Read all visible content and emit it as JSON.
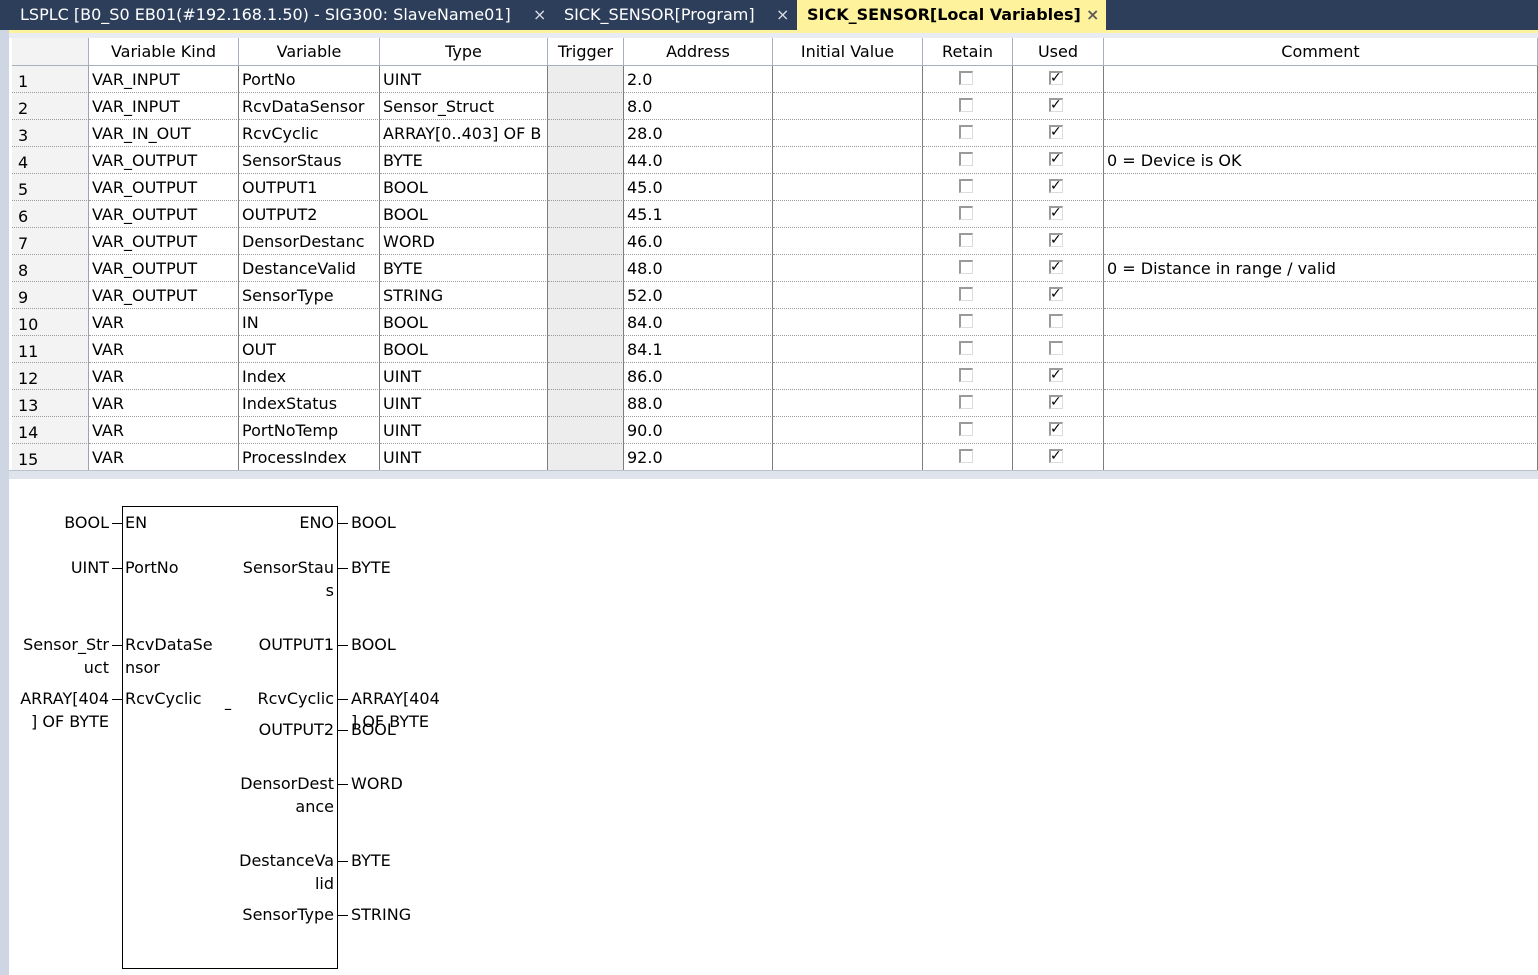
{
  "tabs": [
    {
      "label": "LSPLC [B0_S0 EB01(#192.168.1.50) - SIG300: SlaveName01]",
      "close": "×",
      "active": false
    },
    {
      "label": "SICK_SENSOR[Program]",
      "close": "×",
      "active": false
    },
    {
      "label": "SICK_SENSOR[Local Variables]",
      "close": "×",
      "active": true
    }
  ],
  "columns": [
    "",
    "Variable Kind",
    "Variable",
    "Type",
    "Trigger",
    "Address",
    "Initial Value",
    "Retain",
    "Used",
    "Comment"
  ],
  "rows": [
    {
      "no": "1",
      "kind": "VAR_INPUT",
      "variable": "PortNo",
      "type": "UINT",
      "trigger": "",
      "address": "2.0",
      "initial": "",
      "retain": false,
      "used": true,
      "comment": ""
    },
    {
      "no": "2",
      "kind": "VAR_INPUT",
      "variable": "RcvDataSensor",
      "type": "Sensor_Struct",
      "trigger": "",
      "address": "8.0",
      "initial": "",
      "retain": false,
      "used": true,
      "comment": ""
    },
    {
      "no": "3",
      "kind": "VAR_IN_OUT",
      "variable": "RcvCyclic",
      "type": "ARRAY[0..403] OF B",
      "trigger": "",
      "address": "28.0",
      "initial": "",
      "retain": false,
      "used": true,
      "comment": ""
    },
    {
      "no": "4",
      "kind": "VAR_OUTPUT",
      "variable": "SensorStaus",
      "type": "BYTE",
      "trigger": "",
      "address": "44.0",
      "initial": "",
      "retain": false,
      "used": true,
      "comment": "0 = Device is OK"
    },
    {
      "no": "5",
      "kind": "VAR_OUTPUT",
      "variable": "OUTPUT1",
      "type": "BOOL",
      "trigger": "",
      "address": "45.0",
      "initial": "",
      "retain": false,
      "used": true,
      "comment": ""
    },
    {
      "no": "6",
      "kind": "VAR_OUTPUT",
      "variable": "OUTPUT2",
      "type": "BOOL",
      "trigger": "",
      "address": "45.1",
      "initial": "",
      "retain": false,
      "used": true,
      "comment": ""
    },
    {
      "no": "7",
      "kind": "VAR_OUTPUT",
      "variable": "DensorDestanc",
      "type": "WORD",
      "trigger": "",
      "address": "46.0",
      "initial": "",
      "retain": false,
      "used": true,
      "comment": ""
    },
    {
      "no": "8",
      "kind": "VAR_OUTPUT",
      "variable": "DestanceValid",
      "type": "BYTE",
      "trigger": "",
      "address": "48.0",
      "initial": "",
      "retain": false,
      "used": true,
      "comment": "0 = Distance in range / valid"
    },
    {
      "no": "9",
      "kind": "VAR_OUTPUT",
      "variable": "SensorType",
      "type": "STRING",
      "trigger": "",
      "address": "52.0",
      "initial": "",
      "retain": false,
      "used": true,
      "comment": ""
    },
    {
      "no": "10",
      "kind": "VAR",
      "variable": "IN",
      "type": "BOOL",
      "trigger": "",
      "address": "84.0",
      "initial": "",
      "retain": false,
      "used": false,
      "comment": ""
    },
    {
      "no": "11",
      "kind": "VAR",
      "variable": "OUT",
      "type": "BOOL",
      "trigger": "",
      "address": "84.1",
      "initial": "",
      "retain": false,
      "used": false,
      "comment": ""
    },
    {
      "no": "12",
      "kind": "VAR",
      "variable": "Index",
      "type": "UINT",
      "trigger": "",
      "address": "86.0",
      "initial": "",
      "retain": false,
      "used": true,
      "comment": ""
    },
    {
      "no": "13",
      "kind": "VAR",
      "variable": "IndexStatus",
      "type": "UINT",
      "trigger": "",
      "address": "88.0",
      "initial": "",
      "retain": false,
      "used": true,
      "comment": ""
    },
    {
      "no": "14",
      "kind": "VAR",
      "variable": "PortNoTemp",
      "type": "UINT",
      "trigger": "",
      "address": "90.0",
      "initial": "",
      "retain": false,
      "used": true,
      "comment": ""
    },
    {
      "no": "15",
      "kind": "VAR",
      "variable": "ProcessIndex",
      "type": "UINT",
      "trigger": "",
      "address": "92.0",
      "initial": "",
      "retain": false,
      "used": true,
      "comment": ""
    }
  ],
  "fb": {
    "inputs": [
      {
        "type": [
          "BOOL"
        ],
        "pin": [
          "EN"
        ]
      },
      {
        "type": [
          "UINT"
        ],
        "pin": [
          "PortNo"
        ]
      },
      {
        "type": [
          "Sensor_Str",
          "uct"
        ],
        "pin": [
          "RcvDataSe",
          "nsor"
        ]
      },
      {
        "type": [
          "ARRAY[404",
          "] OF BYTE"
        ],
        "pin": [
          "RcvCyclic"
        ]
      }
    ],
    "outputs": [
      {
        "pin": [
          "ENO"
        ],
        "type": [
          "BOOL"
        ]
      },
      {
        "pin": [
          "SensorStau",
          "s"
        ],
        "type": [
          "BYTE"
        ]
      },
      {
        "pin": [
          "OUTPUT1"
        ],
        "type": [
          "BOOL"
        ]
      },
      {
        "pin": [
          "RcvCyclic"
        ],
        "type": [
          "ARRAY[404",
          "] OF BYTE"
        ]
      },
      {
        "pin": [
          "OUTPUT2"
        ],
        "type": [
          "BOOL"
        ]
      },
      {
        "pin": [
          "DensorDest",
          "ance"
        ],
        "type": [
          "WORD"
        ]
      },
      {
        "pin": [
          "DestanceVa",
          "lid"
        ],
        "type": [
          "BYTE"
        ]
      },
      {
        "pin": [
          "SensorType"
        ],
        "type": [
          "STRING"
        ]
      }
    ],
    "dash": "–"
  }
}
